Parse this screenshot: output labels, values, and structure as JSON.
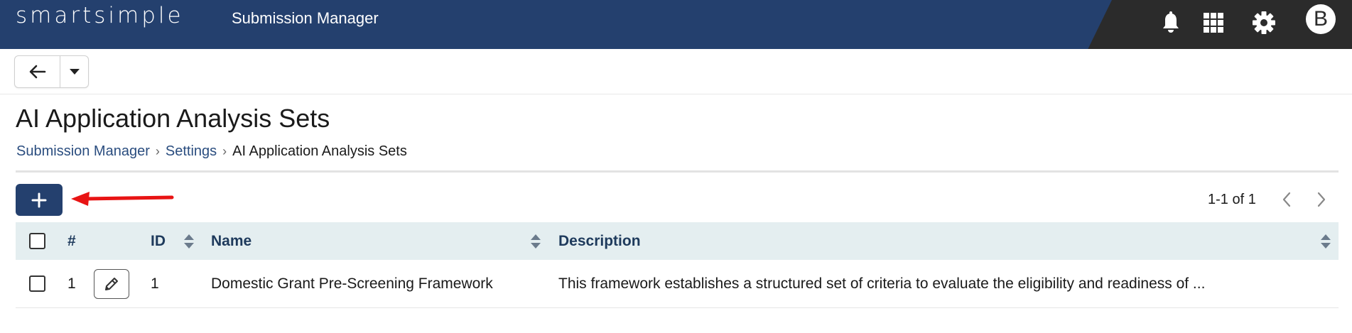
{
  "header": {
    "logo": "smartsimple",
    "app_title": "Submission Manager",
    "icons": [
      "bell-icon",
      "apps-grid-icon",
      "gear-icon"
    ],
    "avatar_initial": "B",
    "colors": {
      "bar": "#24406e",
      "dark_panel": "#2b2b2b"
    }
  },
  "toolbar": {
    "back_icon": "arrow-left-icon",
    "dropdown_icon": "caret-down-icon"
  },
  "page": {
    "title": "AI Application Analysis Sets",
    "breadcrumb": [
      "Submission Manager",
      "Settings",
      "AI Application Analysis Sets"
    ]
  },
  "actions": {
    "add_icon": "plus-icon",
    "annotation": "red-arrow-pointing-left"
  },
  "pagination": {
    "summary": "1-1 of 1",
    "prev_icon": "chevron-left-icon",
    "next_icon": "chevron-right-icon"
  },
  "table": {
    "columns": {
      "number": "#",
      "id": "ID",
      "name": "Name",
      "description": "Description"
    },
    "rows": [
      {
        "number": "1",
        "id": "1",
        "name": "Domestic Grant Pre-Screening Framework",
        "description": "This framework establishes a structured set of criteria to evaluate the eligibility and readiness of ..."
      }
    ]
  }
}
